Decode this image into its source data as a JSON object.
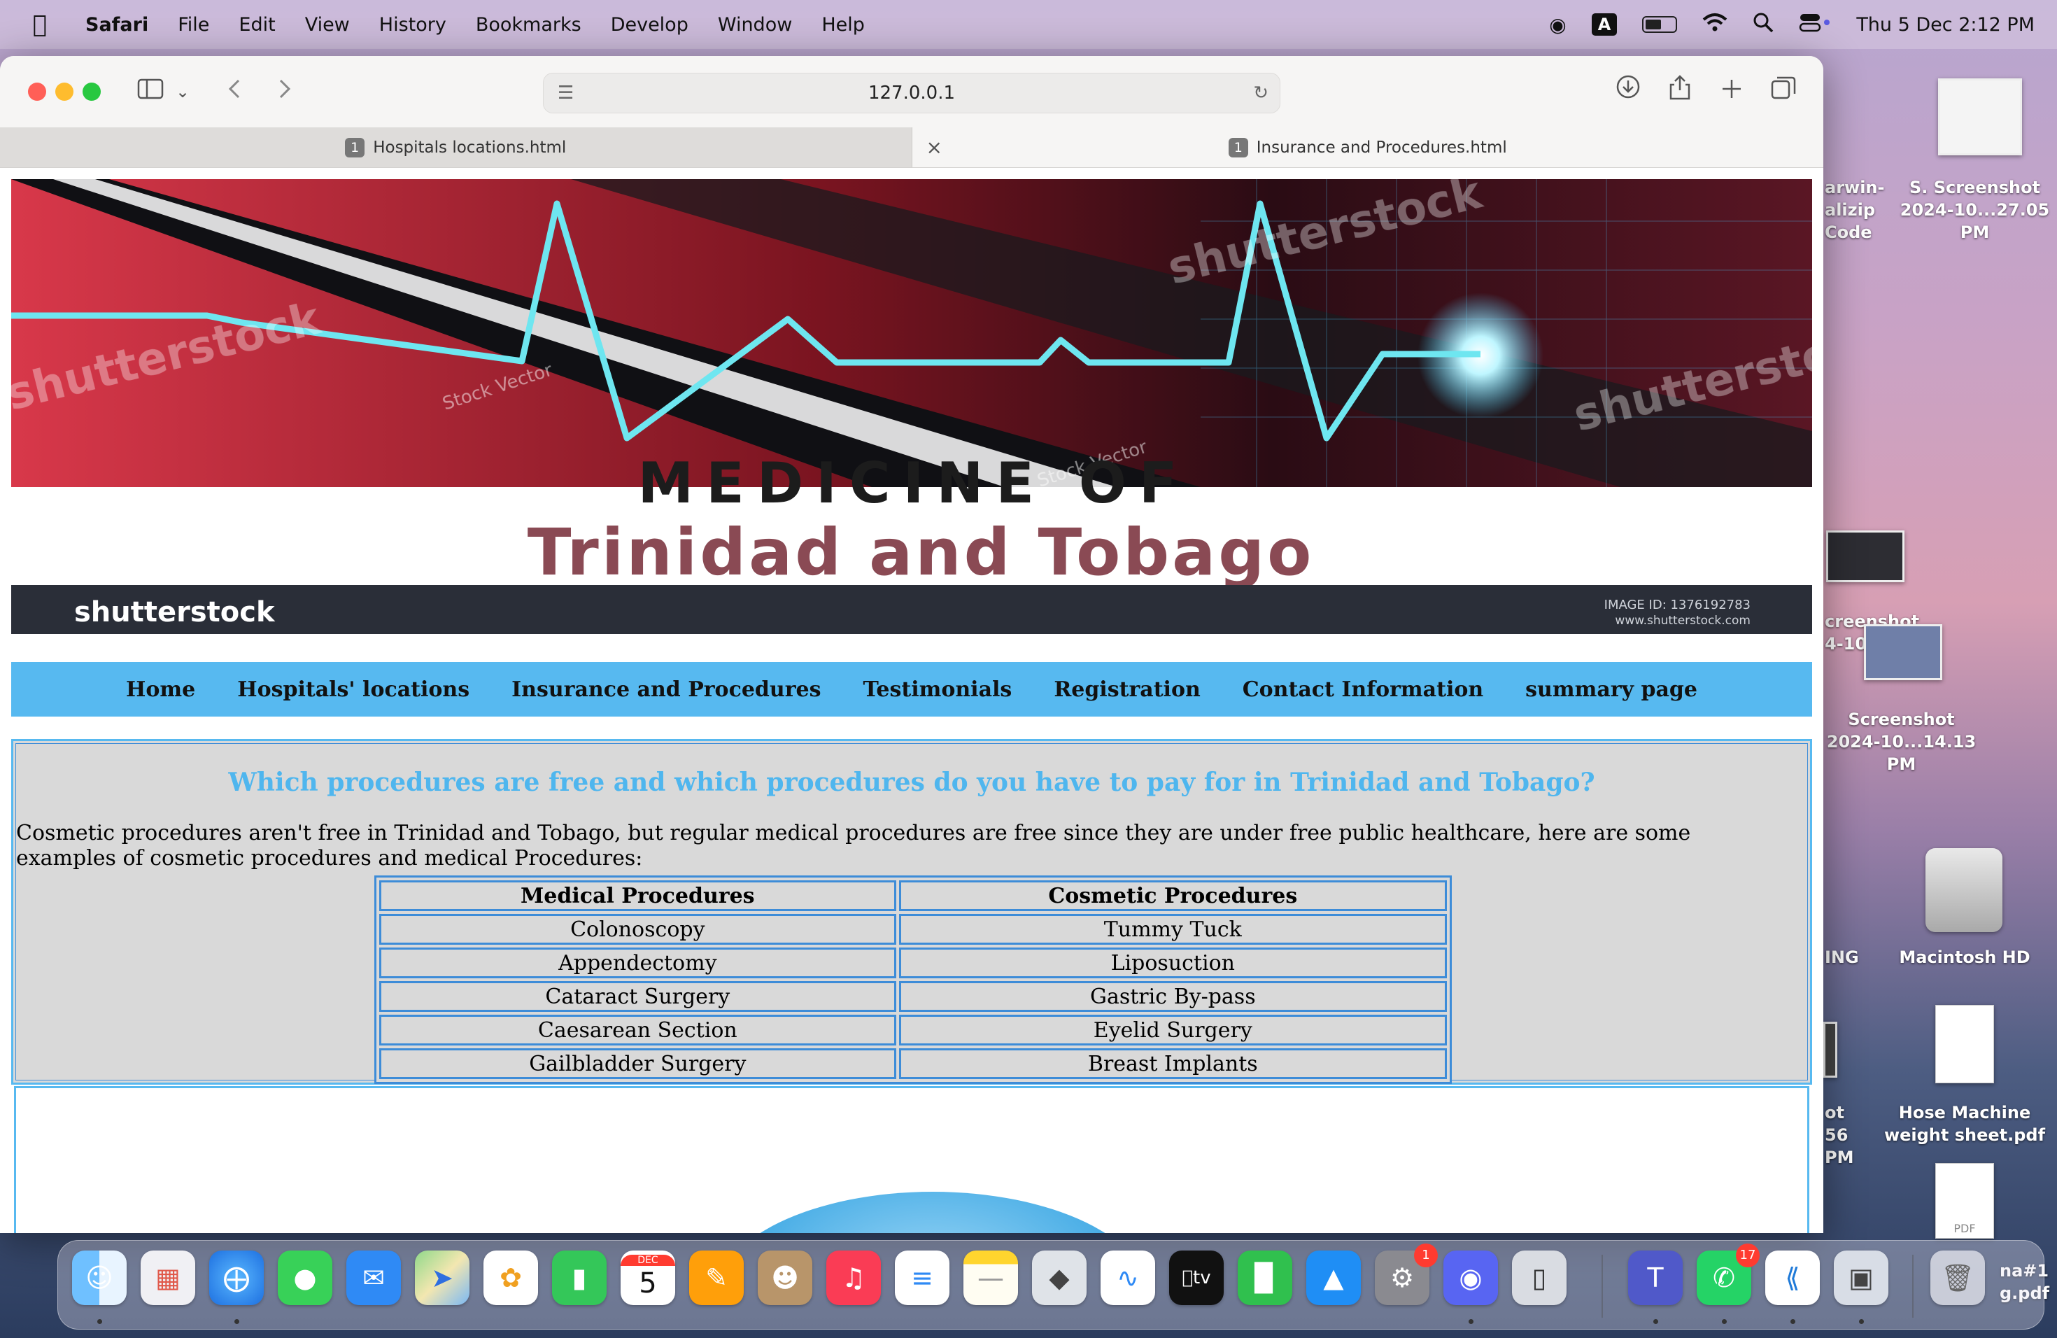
{
  "menubar": {
    "app": "Safari",
    "items": [
      "File",
      "Edit",
      "View",
      "History",
      "Bookmarks",
      "Develop",
      "Window",
      "Help"
    ],
    "input_source": "A",
    "clock": "Thu 5 Dec  2:12 PM"
  },
  "browser": {
    "address": "127.0.0.1",
    "tabs": [
      {
        "number": "1",
        "title": "Hospitals locations.html"
      },
      {
        "number": "1",
        "title": "Insurance and Procedures.html"
      }
    ]
  },
  "banner": {
    "line1": "MEDICINE OF",
    "line2": "Trinidad and Tobago",
    "stock_brand": "shutterstock",
    "watermark": "shutterstock",
    "stock_vector": "Stock Vector",
    "image_id": "IMAGE ID: 1376192783",
    "site": "www.shutterstock.com"
  },
  "nav": [
    "Home",
    "Hospitals' locations",
    "Insurance and Procedures",
    "Testimonials",
    "Registration",
    "Contact Information",
    "summary page"
  ],
  "section": {
    "heading": "Which procedures are free and which procedures do you have to pay for in Trinidad and Tobago?",
    "intro": "Cosmetic procedures aren't free in Trinidad and Tobago, but regular medical procedures are free since they are under free public healthcare, here are some examples of cosmetic procedures and medical Procedures:",
    "table": {
      "headers": [
        "Medical Procedures",
        "Cosmetic Procedures"
      ],
      "rows": [
        [
          "Colonoscopy",
          "Tummy Tuck"
        ],
        [
          "Appendectomy",
          "Liposuction"
        ],
        [
          "Cataract Surgery",
          "Gastric By-pass"
        ],
        [
          "Caesarean Section",
          "Eyelid Surgery"
        ],
        [
          "Gailbladder Surgery",
          "Breast Implants"
        ]
      ]
    }
  },
  "desktop": {
    "items": [
      "arwin-",
      "alizip Code",
      "S. Screenshot",
      "2024-10...27.05 PM",
      "creenshot",
      "4-10.",
      "Screenshot",
      "2024-10...14.13 PM",
      "ING",
      "Macintosh HD",
      "ot",
      "56 PM",
      "Hose Machine",
      "weight sheet.pdf",
      "PDF",
      "na#1",
      "g.pdf"
    ]
  },
  "dock": {
    "calendar_month": "DEC",
    "calendar_day": "5",
    "settings_badge": "1",
    "whatsapp_badge": "17"
  }
}
